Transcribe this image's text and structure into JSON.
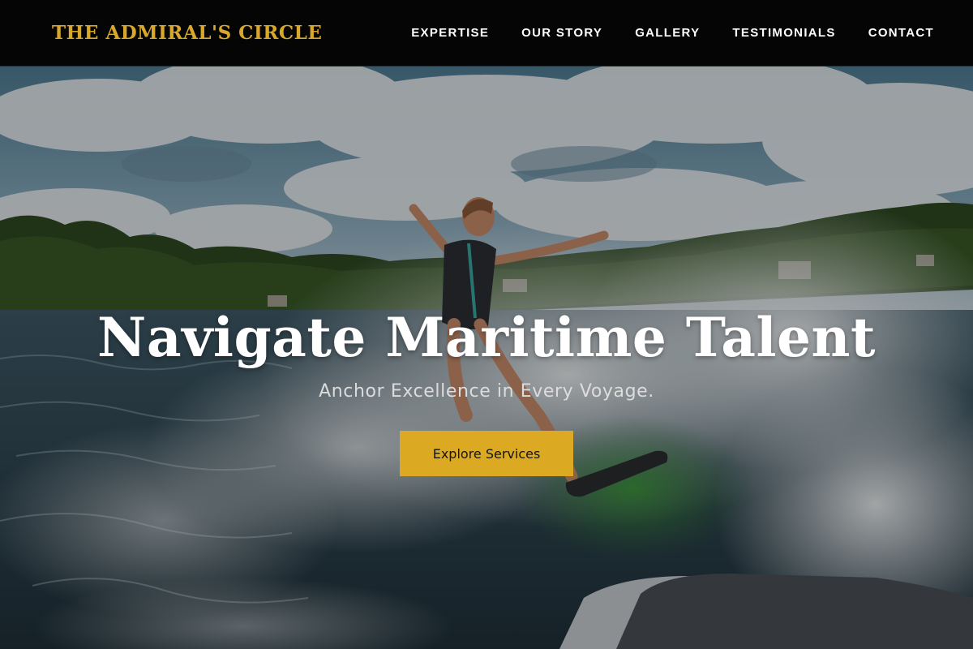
{
  "brand": {
    "name": "THE ADMIRAL'S CIRCLE",
    "color": "#d9a82a"
  },
  "nav": {
    "items": [
      {
        "label": "EXPERTISE"
      },
      {
        "label": "OUR STORY"
      },
      {
        "label": "GALLERY"
      },
      {
        "label": "TESTIMONIALS"
      },
      {
        "label": "CONTACT"
      }
    ]
  },
  "hero": {
    "title": "Navigate Maritime Talent",
    "subtitle": "Anchor Excellence in Every Voyage.",
    "cta_label": "Explore Services",
    "cta_color": "#dba922",
    "background_image": "wakeboarder-on-lake-photo"
  }
}
